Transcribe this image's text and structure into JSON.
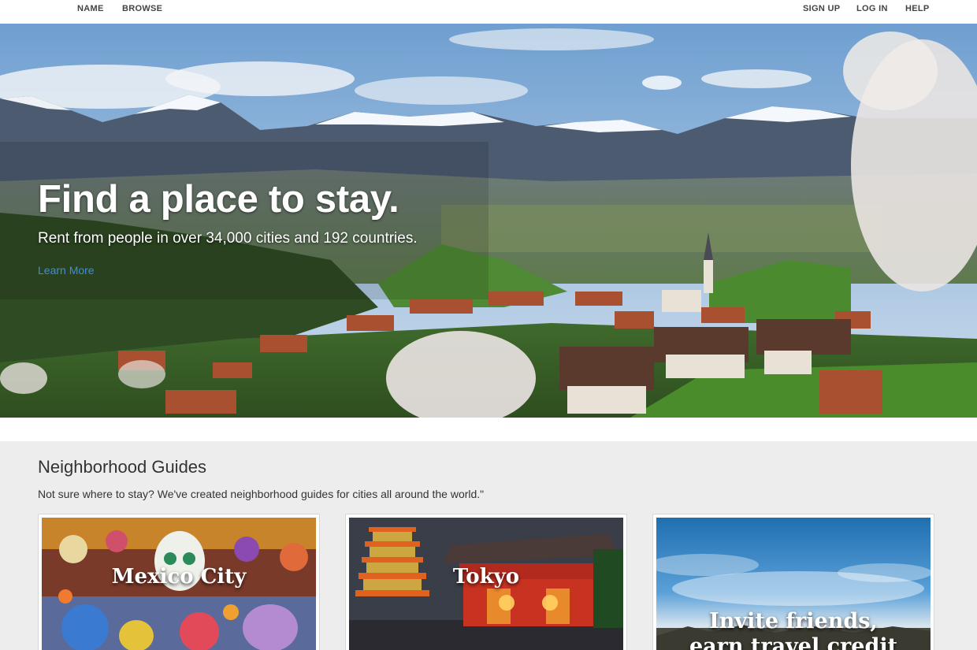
{
  "nav": {
    "left": [
      {
        "label": "NAME"
      },
      {
        "label": "BROWSE"
      }
    ],
    "right": [
      {
        "label": "SIGN UP"
      },
      {
        "label": "LOG IN"
      },
      {
        "label": "HELP"
      }
    ]
  },
  "hero": {
    "title": "Find a place to stay.",
    "subtitle": "Rent from people in over 34,000 cities and 192 countries.",
    "link": "Learn More"
  },
  "guides": {
    "title": "Neighborhood Guides",
    "description": "Not sure where to stay? We've created neighborhood guides for cities all around the world.\"",
    "cards": [
      {
        "label": "Mexico City"
      },
      {
        "label": "Tokyo"
      },
      {
        "label_line1": "Invite friends,",
        "label_line2": "earn travel credit"
      }
    ]
  },
  "colors": {
    "link": "#3b8fe0",
    "section_bg": "#ededed",
    "nav_text": "#444444"
  }
}
